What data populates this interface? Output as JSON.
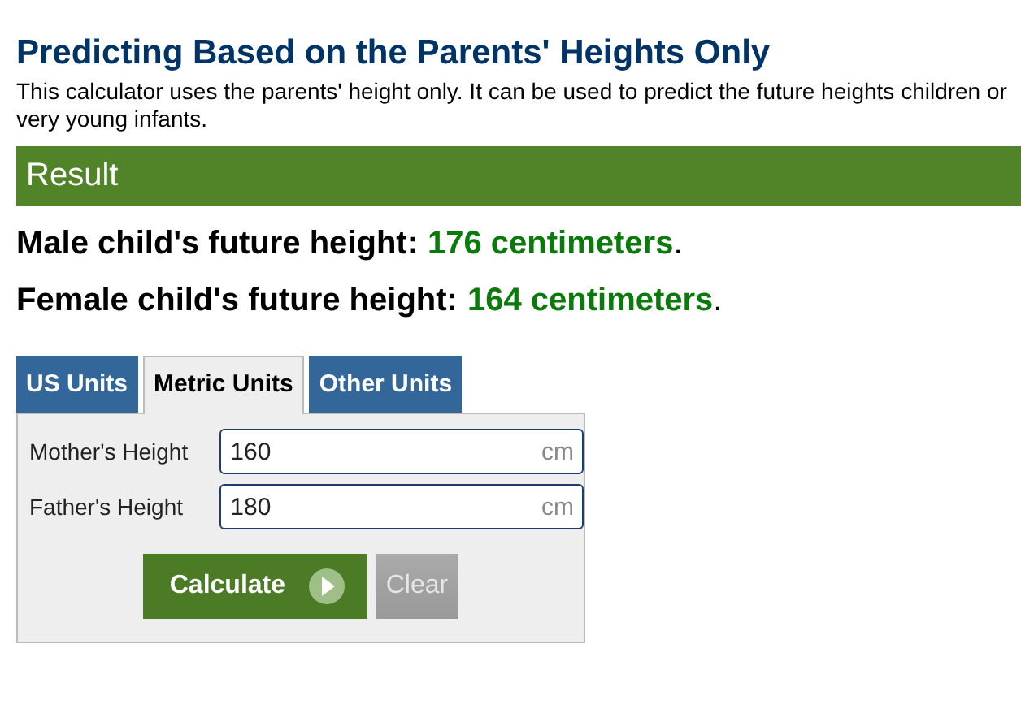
{
  "heading": "Predicting Based on the Parents' Heights Only",
  "description": "This calculator uses the parents' height only. It can be used to predict the future heights children or very young infants.",
  "result_bar": {
    "title": "Result"
  },
  "results": [
    {
      "label": "Male child's future height:",
      "value": "176 centimeters",
      "end": "."
    },
    {
      "label": "Female child's future height:",
      "value": "164 centimeters",
      "end": "."
    }
  ],
  "tabs": [
    {
      "label": "US Units",
      "selected": false
    },
    {
      "label": "Metric Units",
      "selected": true
    },
    {
      "label": "Other Units",
      "selected": false
    }
  ],
  "fields": [
    {
      "label": "Mother's Height",
      "value": "160",
      "unit": "cm"
    },
    {
      "label": "Father's Height",
      "value": "180",
      "unit": "cm"
    }
  ],
  "buttons": [
    {
      "label": "Calculate",
      "kind": "primary"
    },
    {
      "label": "Clear",
      "kind": "secondary"
    }
  ]
}
